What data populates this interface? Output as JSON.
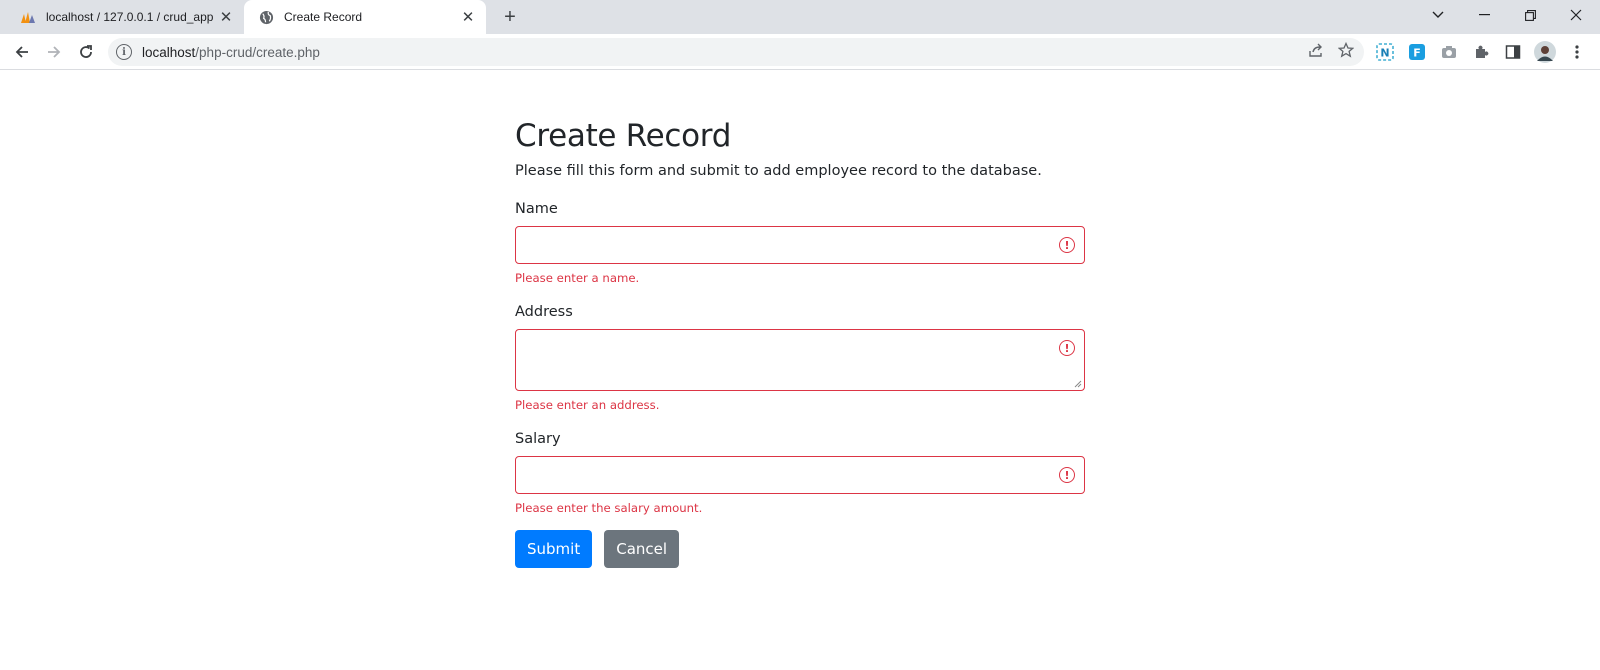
{
  "browser": {
    "tabs": [
      {
        "title": "localhost / 127.0.0.1 / crud_app | ",
        "icon": "phpmyadmin-icon",
        "active": false
      },
      {
        "title": "Create Record",
        "icon": "globe-icon",
        "active": true
      }
    ],
    "url_host": "localhost",
    "url_path": "/php-crud/create.php"
  },
  "page": {
    "title": "Create Record",
    "description": "Please fill this form and submit to add employee record to the database.",
    "fields": [
      {
        "label": "Name",
        "value": "",
        "error": "Please enter a name."
      },
      {
        "label": "Address",
        "value": "",
        "error": "Please enter an address."
      },
      {
        "label": "Salary",
        "value": "",
        "error": "Please enter the salary amount."
      }
    ],
    "submit_label": "Submit",
    "cancel_label": "Cancel",
    "colors": {
      "primary": "#007bff",
      "secondary": "#6c757d",
      "danger": "#dc3545"
    }
  }
}
